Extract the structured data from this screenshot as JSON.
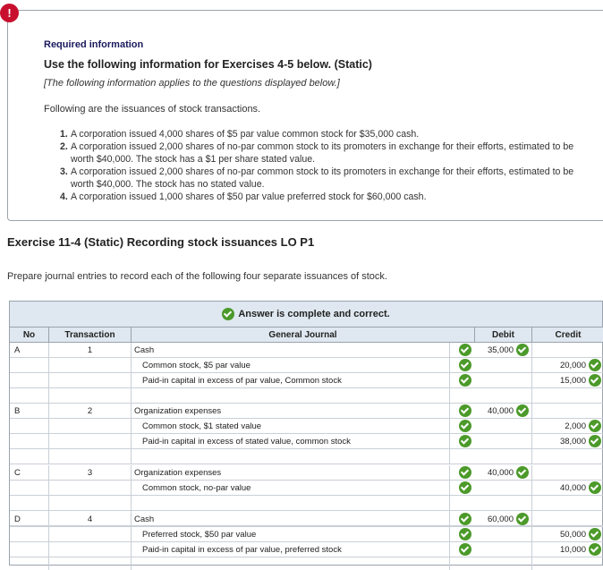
{
  "required": {
    "badge": "!",
    "title": "Required information",
    "heading": "Use the following information for Exercises 4-5 below. (Static)",
    "note": "[The following information applies to the questions displayed below.]",
    "intro": "Following are the issuances of stock transactions.",
    "items": [
      {
        "num": "1.",
        "text": "A corporation issued 4,000 shares of $5 par value common stock for $35,000 cash."
      },
      {
        "num": "2.",
        "text": "A corporation issued 2,000 shares of no-par common stock to its promoters in exchange for their efforts, estimated to be worth $40,000. The stock has a $1 per share stated value."
      },
      {
        "num": "3.",
        "text": "A corporation issued 2,000 shares of no-par common stock to its promoters in exchange for their efforts, estimated to be worth $40,000. The stock has no stated value."
      },
      {
        "num": "4.",
        "text": "A corporation issued 1,000 shares of $50 par value preferred stock for $60,000 cash."
      }
    ]
  },
  "exercise": {
    "title": "Exercise 11-4 (Static) Recording stock issuances LO P1",
    "instructions": "Prepare journal entries to record each of the following four separate issuances of stock."
  },
  "journal": {
    "status": "Answer is complete and correct.",
    "headers": {
      "no": "No",
      "transaction": "Transaction",
      "general_journal": "General Journal",
      "debit": "Debit",
      "credit": "Credit"
    },
    "entries": [
      {
        "no": "A",
        "transaction": "1",
        "lines": [
          {
            "account": "Cash",
            "debit": "35,000",
            "credit": ""
          },
          {
            "account": "Common stock, $5 par value",
            "debit": "",
            "credit": "20,000"
          },
          {
            "account": "Paid-in capital in excess of par value, Common stock",
            "debit": "",
            "credit": "15,000"
          }
        ]
      },
      {
        "no": "B",
        "transaction": "2",
        "lines": [
          {
            "account": "Organization expenses",
            "debit": "40,000",
            "credit": ""
          },
          {
            "account": "Common stock, $1 stated value",
            "debit": "",
            "credit": "2,000"
          },
          {
            "account": "Paid-in capital in excess of stated value, common stock",
            "debit": "",
            "credit": "38,000"
          }
        ]
      },
      {
        "no": "C",
        "transaction": "3",
        "lines": [
          {
            "account": "Organization expenses",
            "debit": "40,000",
            "credit": ""
          },
          {
            "account": "Common stock, no-par value",
            "debit": "",
            "credit": "40,000"
          }
        ]
      },
      {
        "no": "D",
        "transaction": "4",
        "lines": [
          {
            "account": "Cash",
            "debit": "60,000",
            "credit": ""
          },
          {
            "account": "Preferred stock, $50 par value",
            "debit": "",
            "credit": "50,000"
          },
          {
            "account": "Paid-in capital in excess of par value, preferred stock",
            "debit": "",
            "credit": "10,000"
          }
        ]
      }
    ]
  }
}
